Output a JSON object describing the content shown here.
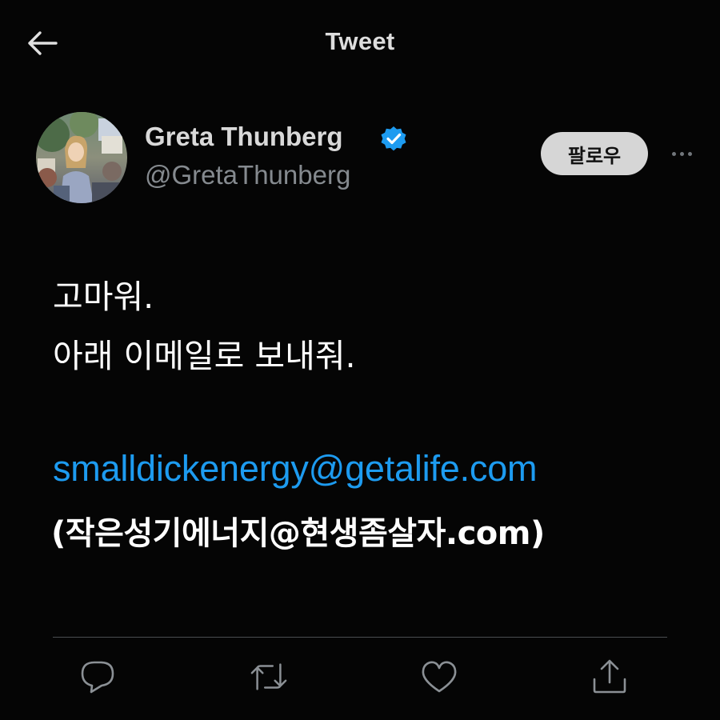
{
  "header": {
    "title": "Tweet",
    "back_icon": "arrow-left-icon"
  },
  "author": {
    "display_name": "Greta Thunberg",
    "handle": "@GretaThunberg",
    "verified": true,
    "verified_icon": "verified-badge-icon",
    "avatar_icon": "avatar"
  },
  "follow_button": {
    "label": "팔로우"
  },
  "more_icon": "more-horizontal-icon",
  "tweet": {
    "lines": [
      "고마워.",
      "아래 이메일로 보내줘."
    ],
    "email": "smalldickenergy@getalife.com",
    "email_translation": "(작은성기에너지@현생좀살자.com)"
  },
  "actions": [
    {
      "name": "reply",
      "icon": "reply-icon"
    },
    {
      "name": "retweet",
      "icon": "retweet-icon"
    },
    {
      "name": "like",
      "icon": "heart-icon"
    },
    {
      "name": "share",
      "icon": "share-icon"
    }
  ],
  "colors": {
    "background": "#050505",
    "link": "#1d9bf0",
    "verified": "#1d9bf0",
    "text_primary": "#ffffff",
    "text_secondary": "#858a8f",
    "follow_bg": "#d6d6d6"
  }
}
